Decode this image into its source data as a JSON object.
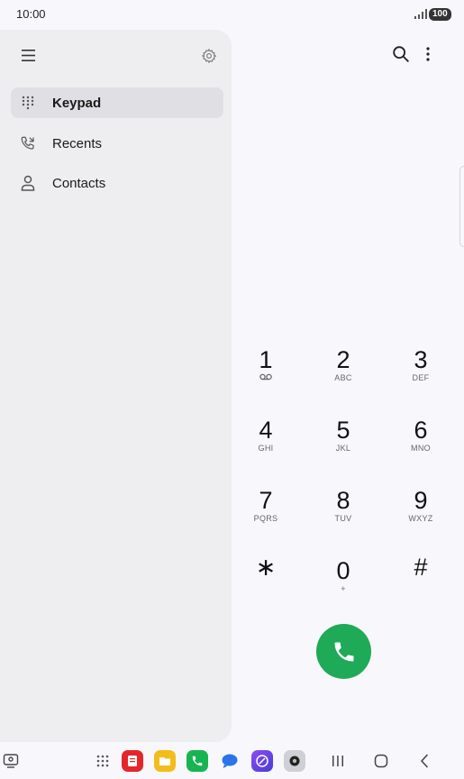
{
  "status_bar": {
    "time": "10:00",
    "battery": "100"
  },
  "drawer": {
    "items": [
      {
        "label": "Keypad",
        "icon": "dialpad-icon",
        "active": true
      },
      {
        "label": "Recents",
        "icon": "recent-calls-icon",
        "active": false
      },
      {
        "label": "Contacts",
        "icon": "person-icon",
        "active": false
      }
    ]
  },
  "keypad": {
    "keys": [
      {
        "digit": "1",
        "letters": ""
      },
      {
        "digit": "2",
        "letters": "ABC"
      },
      {
        "digit": "3",
        "letters": "DEF"
      },
      {
        "digit": "4",
        "letters": "GHI"
      },
      {
        "digit": "5",
        "letters": "JKL"
      },
      {
        "digit": "6",
        "letters": "MNO"
      },
      {
        "digit": "7",
        "letters": "PQRS"
      },
      {
        "digit": "8",
        "letters": "TUV"
      },
      {
        "digit": "9",
        "letters": "WXYZ"
      },
      {
        "digit": "∗",
        "letters": ""
      },
      {
        "digit": "0",
        "letters": "+"
      },
      {
        "digit": "#",
        "letters": ""
      }
    ]
  },
  "colors": {
    "call_green": "#1eaa57",
    "drawer_bg": "#eeeef1",
    "active_item_bg": "#e0e0e4"
  },
  "taskbar": {
    "apps": [
      "apps-grid-icon",
      "notes-app-icon",
      "my-files-app-icon",
      "phone-app-icon",
      "messages-app-icon",
      "internet-app-icon",
      "camera-app-icon"
    ]
  }
}
